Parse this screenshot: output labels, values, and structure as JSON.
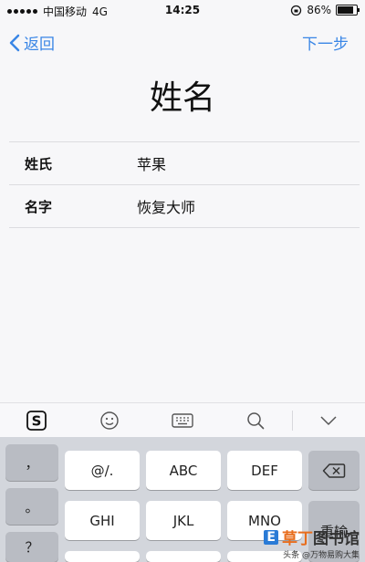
{
  "status_bar": {
    "carrier": "中国移动",
    "network": "4G",
    "time": "14:25",
    "battery_text": "86%",
    "battery_level": 0.86
  },
  "nav": {
    "back_label": "返回",
    "next_label": "下一步"
  },
  "page": {
    "title": "姓名"
  },
  "form": {
    "rows": [
      {
        "label": "姓氏",
        "value": "苹果"
      },
      {
        "label": "名字",
        "value": "恢复大师"
      }
    ]
  },
  "keyboard_toolbar": {
    "icons": [
      "sogou-logo-icon",
      "emoji-icon",
      "keyboard-icon",
      "search-icon",
      "collapse-icon"
    ],
    "sogou_letter": "S"
  },
  "keyboard": {
    "left_keys": [
      "，",
      "。",
      "？"
    ],
    "row1": [
      "@/.",
      "ABC",
      "DEF"
    ],
    "row2": [
      "GHI",
      "JKL",
      "MNO"
    ],
    "right_keys": [
      "重输"
    ],
    "delete_icon": "backspace-icon"
  },
  "watermark": {
    "letter": "E",
    "name_a": "草丁",
    "name_b": "图书馆",
    "sub": "头条 @万物易购大集"
  }
}
